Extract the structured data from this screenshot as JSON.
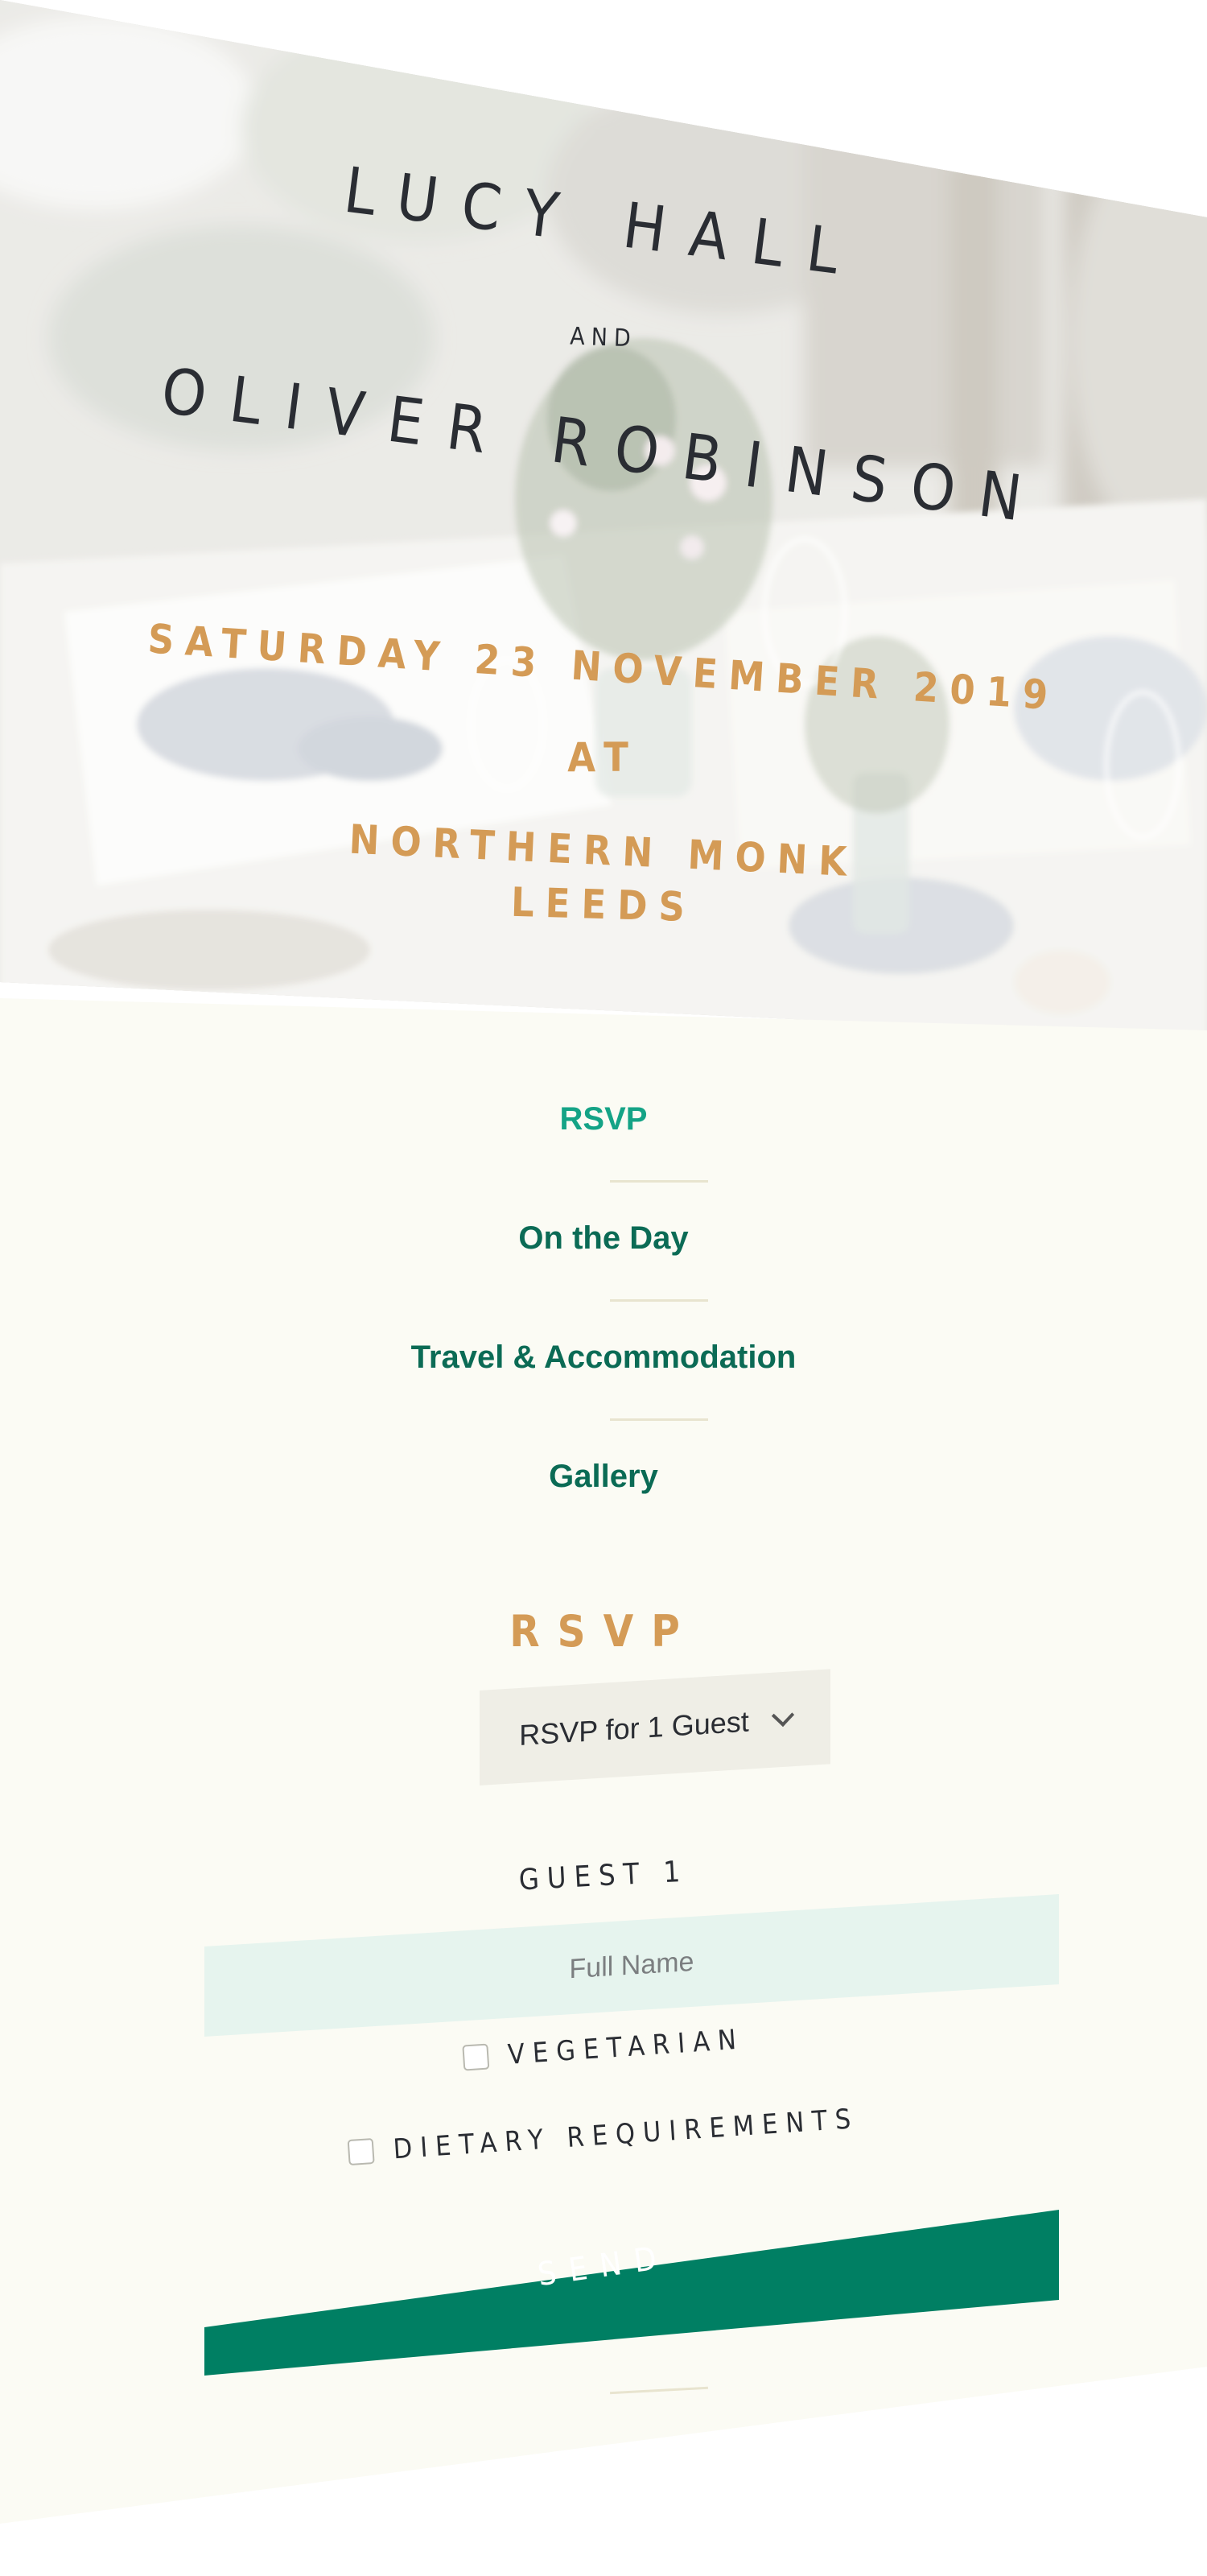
{
  "hero": {
    "name_one": "LUCY HALL",
    "and_word": "AND",
    "name_two": "OLIVER ROBINSON",
    "date_line": "SATURDAY 23 NOVEMBER 2019",
    "at_word": "AT",
    "venue": "NORTHERN MONK",
    "city": "LEEDS",
    "text_color": "#2a2d33",
    "accent_color": "#d49b56"
  },
  "nav": {
    "items": [
      {
        "label": "RSVP",
        "active": true
      },
      {
        "label": "On the Day",
        "active": false
      },
      {
        "label": "Travel & Accommodation",
        "active": false
      },
      {
        "label": "Gallery",
        "active": false
      }
    ],
    "color": "#0b6b55",
    "active_color": "#14a386"
  },
  "rsvp": {
    "heading": "RSVP",
    "guest_select": {
      "selected": "RSVP for 1 Guest",
      "icon": "chevron-down-icon"
    },
    "guest_label": "GUEST 1",
    "name_placeholder": "Full Name",
    "options": [
      {
        "label": "VEGETARIAN",
        "checked": false
      },
      {
        "label": "DIETARY REQUIREMENTS",
        "checked": false
      }
    ],
    "send_label": "SEND",
    "button_color": "#007f63"
  }
}
